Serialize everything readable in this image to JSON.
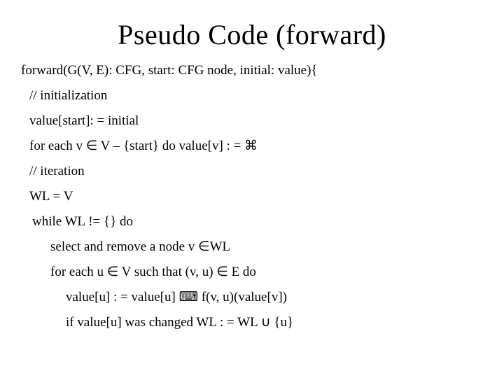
{
  "title": "Pseudo Code (forward)",
  "lines": {
    "l0": "forward(G(V, E): CFG, start: CFG node, initial: value){",
    "l1": "// initialization",
    "l2": "value[start]: = initial",
    "l3": "for each v ∈ V – {start} do value[v] : = ⌘",
    "l4": "// iteration",
    "l5": "WL = V",
    "l6": "while WL != {} do",
    "l7": "select and remove a node v ∈WL",
    "l8": "for each u ∈ V such that (v, u) ∈ E do",
    "l9": "value[u] : = value[u] ⌨ f(v, u)(value[v])",
    "l10": "if value[u] was changed WL : = WL ∪ {u}"
  }
}
